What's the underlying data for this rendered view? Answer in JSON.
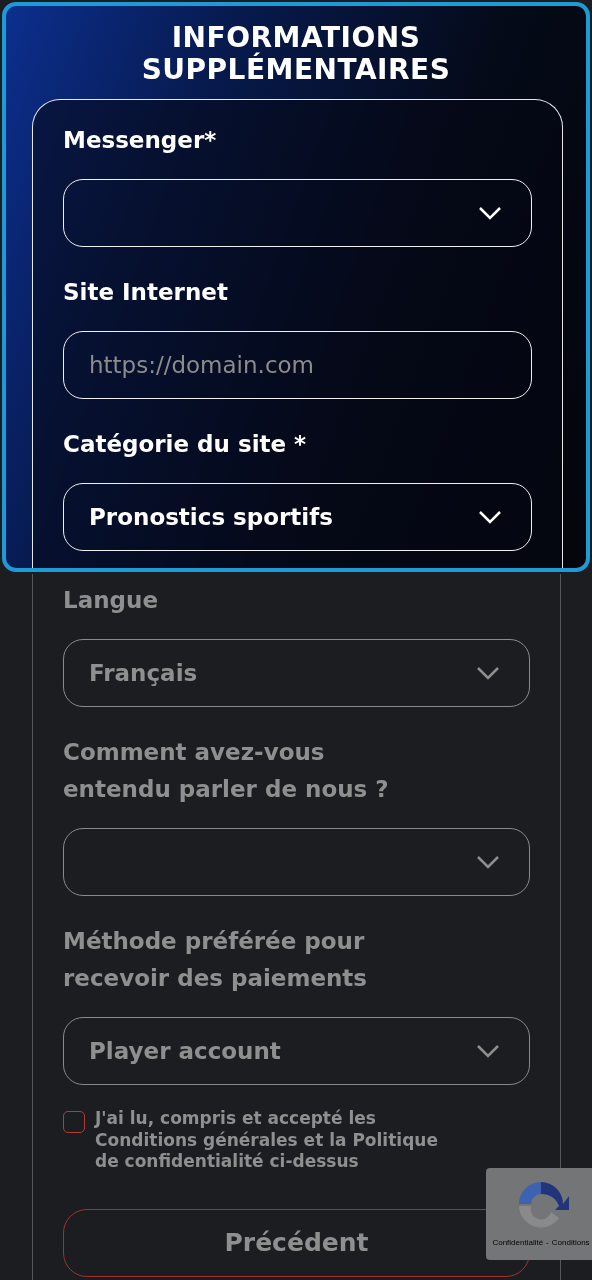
{
  "title": "INFORMATIONS SUPPLÉMENTAIRES",
  "fields": [
    {
      "label": "Messenger*",
      "kind": "select",
      "highlighted": true
    },
    {
      "label": "Site Internet",
      "kind": "text",
      "placeholder": "https://domain.com",
      "highlighted": true
    },
    {
      "label": "Catégorie du site *",
      "kind": "select",
      "value": "Pronostics sportifs",
      "highlighted": true
    },
    {
      "label": "Langue",
      "kind": "select",
      "value": "Français",
      "highlighted": false
    },
    {
      "label": "Comment avez-vous entendu parler de nous ?",
      "kind": "select",
      "highlighted": false
    },
    {
      "label": "Méthode préférée pour recevoir des paiements",
      "kind": "select",
      "value": "Player account",
      "highlighted": false
    }
  ],
  "consent": {
    "text": "J'ai lu, compris et accepté les Conditions générales et la Politique de confidentialité ci-dessus",
    "checked": false
  },
  "back_button": "Précédent",
  "recaptcha": {
    "links": [
      "Confidentialité",
      "Conditions"
    ],
    "separator": "-"
  }
}
